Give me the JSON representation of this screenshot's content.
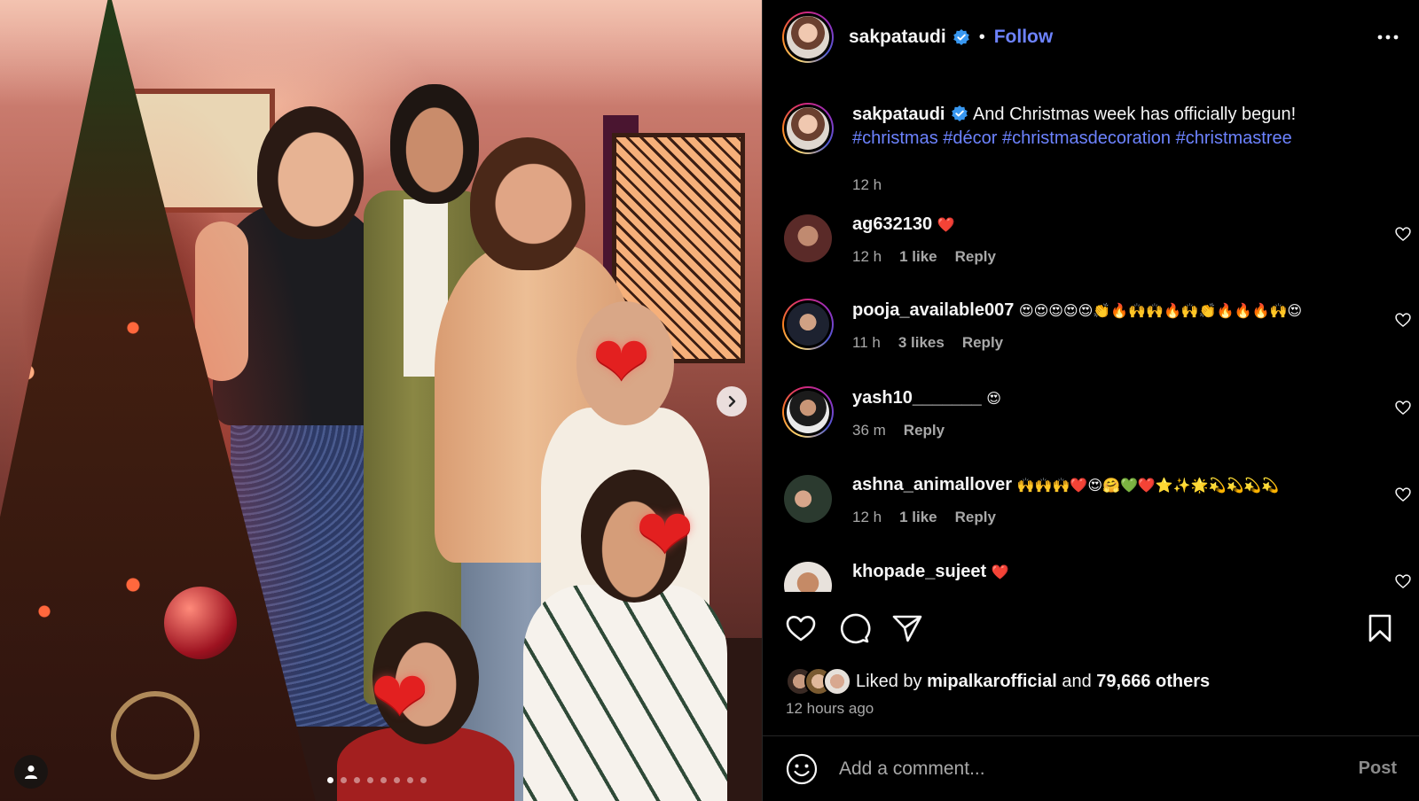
{
  "header": {
    "username": "sakpataudi",
    "verified": true,
    "separator": "•",
    "follow_label": "Follow",
    "more_icon": "more-horizontal-icon"
  },
  "caption": {
    "username": "sakpataudi",
    "text": "And Christmas week has officially begun!",
    "hashtags": "#christmas #décor #christmasdecoration #christmastree",
    "time": "12 h"
  },
  "comments": [
    {
      "username": "ag632130",
      "text": "❤️",
      "time": "12 h",
      "likes": "1 like",
      "reply": "Reply"
    },
    {
      "username": "pooja_available007",
      "text": "😍😍😍😍😍👏🔥🙌🙌🔥🙌👏🔥🔥🔥🙌😍",
      "time": "11 h",
      "likes": "3 likes",
      "reply": "Reply"
    },
    {
      "username": "yash10_______",
      "text": "😍",
      "time": "36 m",
      "likes": "",
      "reply": "Reply"
    },
    {
      "username": "ashna_animallover",
      "text": "🙌🙌🙌❤️😍🤗💚❤️⭐✨🌟💫💫💫💫",
      "time": "12 h",
      "likes": "1 like",
      "reply": "Reply"
    },
    {
      "username": "khopade_sujeet",
      "text": "❤️",
      "time": "",
      "likes": "",
      "reply": ""
    }
  ],
  "actions": {
    "like_icon": "heart-icon",
    "comment_icon": "comment-icon",
    "share_icon": "paper-plane-icon",
    "save_icon": "bookmark-icon"
  },
  "likes": {
    "prefix": "Liked by",
    "liker": "mipalkarofficial",
    "and": "and",
    "others": "79,666 others"
  },
  "posted": "12 hours ago",
  "comment_box": {
    "placeholder": "Add a comment...",
    "post_label": "Post"
  },
  "media": {
    "carousel_total": 8,
    "carousel_active": 1,
    "next_icon": "chevron-right-icon",
    "tag_icon": "user-tag-icon"
  },
  "colors": {
    "accent": "#6d83ff",
    "background": "#000000",
    "muted": "#a8a8a8"
  }
}
